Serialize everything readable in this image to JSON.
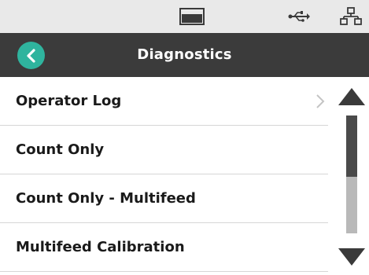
{
  "status_bar": {
    "icons": [
      "display-icon",
      "usb-icon",
      "network-icon"
    ]
  },
  "header": {
    "title": "Diagnostics",
    "back_icon": "back-arrow-icon",
    "accent_color": "#2fb49e",
    "background_color": "#3b3b3b"
  },
  "list": {
    "items": [
      {
        "label": "Operator Log",
        "has_chevron": true
      },
      {
        "label": "Count Only",
        "has_chevron": false
      },
      {
        "label": "Count Only - Multifeed",
        "has_chevron": false
      },
      {
        "label": "Multifeed Calibration",
        "has_chevron": false
      }
    ]
  },
  "scrollbar": {
    "up_icon": "scroll-up-arrow-icon",
    "down_icon": "scroll-down-arrow-icon",
    "position_fraction": 0.0,
    "visible_fraction": 0.52
  }
}
